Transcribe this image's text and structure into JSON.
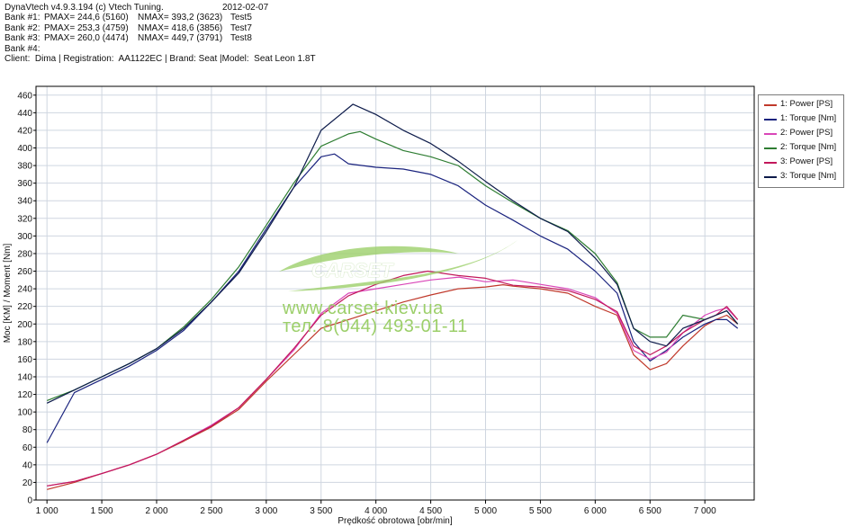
{
  "header": {
    "line1": {
      "app": "DynaVtech v4.9.3.194 (c) Vtech Tuning.",
      "date": "2012-02-07"
    },
    "banks": [
      {
        "label": "Bank #1:",
        "pmax": "PMAX= 244,6 (5160)",
        "nmax": "NMAX= 393,2 (3623)",
        "test": "Test5"
      },
      {
        "label": "Bank #2:",
        "pmax": "PMAX= 253,3 (4759)",
        "nmax": "NMAX= 418,6 (3856)",
        "test": "Test7"
      },
      {
        "label": "Bank #3:",
        "pmax": "PMAX= 260,0 (4474)",
        "nmax": "NMAX= 449,7 (3791)",
        "test": "Test8"
      },
      {
        "label": "Bank #4:",
        "pmax": "",
        "nmax": "",
        "test": ""
      }
    ],
    "client_line": "Client:  Dima | Registration:  AA1122EC | Brand: Seat |Model:  Seat Leon 1.8T"
  },
  "watermark": {
    "brand": "CARSET",
    "url": "www.carset.kiev.ua",
    "phone": "тел. 8(044) 493-01-11"
  },
  "colors": {
    "frame": "#000000",
    "grid": "#cfd6e0",
    "bg": "#ffffff",
    "watermark": "#9ccf6a"
  },
  "chart_data": {
    "type": "line",
    "xlabel": "Prędkość obrotowa [obr/min]",
    "ylabel": "Moc [KM] / Moment [Nm]",
    "xlim": [
      900,
      7450
    ],
    "ylim": [
      0,
      470
    ],
    "x_ticks": [
      1000,
      1500,
      2000,
      2500,
      3000,
      3500,
      4000,
      4500,
      5000,
      5500,
      6000,
      6500,
      7000
    ],
    "x_tick_labels": [
      "1 000",
      "1 500",
      "2 000",
      "2 500",
      "3 000",
      "3 500",
      "4 000",
      "4 500",
      "5 000",
      "5 500",
      "6 000",
      "6 500",
      "7 000"
    ],
    "y_ticks": [
      0,
      20,
      40,
      60,
      80,
      100,
      120,
      140,
      160,
      180,
      200,
      220,
      240,
      260,
      280,
      300,
      320,
      340,
      360,
      380,
      400,
      420,
      440,
      460
    ],
    "grid": true,
    "legend_position": "right",
    "series": [
      {
        "name": "1: Power [PS]",
        "color": "#c0392b",
        "x": [
          1000,
          1250,
          1500,
          1750,
          2000,
          2250,
          2500,
          2750,
          3000,
          3250,
          3500,
          3750,
          4000,
          4250,
          4500,
          4750,
          5000,
          5160,
          5250,
          5500,
          5750,
          6000,
          6200,
          6350,
          6500,
          6650,
          6800,
          7000,
          7100,
          7200,
          7300
        ],
        "y": [
          12,
          20,
          30,
          40,
          52,
          67,
          83,
          103,
          135,
          165,
          195,
          205,
          215,
          225,
          233,
          240,
          242,
          244.6,
          243,
          240,
          235,
          220,
          210,
          165,
          148,
          155,
          175,
          198,
          205,
          210,
          200
        ]
      },
      {
        "name": "1: Torque [Nm]",
        "color": "#1a237e",
        "x": [
          1000,
          1250,
          1500,
          1750,
          2000,
          2250,
          2500,
          2750,
          3000,
          3250,
          3500,
          3623,
          3750,
          4000,
          4250,
          4500,
          4750,
          5000,
          5250,
          5500,
          5750,
          6000,
          6200,
          6350,
          6500,
          6650,
          6800,
          7000,
          7100,
          7200,
          7300
        ],
        "y": [
          65,
          122,
          137,
          152,
          170,
          193,
          225,
          260,
          308,
          355,
          390,
          393.2,
          382,
          378,
          376,
          370,
          357,
          335,
          318,
          300,
          285,
          260,
          235,
          180,
          158,
          170,
          185,
          200,
          205,
          205,
          195
        ]
      },
      {
        "name": "2: Power [PS]",
        "color": "#d946b8",
        "x": [
          1000,
          1250,
          1500,
          1750,
          2000,
          2250,
          2500,
          2750,
          3000,
          3250,
          3500,
          3750,
          4000,
          4250,
          4500,
          4759,
          5000,
          5250,
          5500,
          5750,
          6000,
          6200,
          6350,
          6500,
          6650,
          6800,
          7000,
          7100,
          7200,
          7300
        ],
        "y": [
          16,
          21,
          30,
          40,
          52,
          68,
          85,
          105,
          137,
          170,
          212,
          235,
          240,
          245,
          250,
          253.3,
          248,
          250,
          245,
          240,
          230,
          212,
          170,
          160,
          168,
          190,
          210,
          215,
          218,
          205
        ]
      },
      {
        "name": "2: Torque [Nm]",
        "color": "#2e7d32",
        "x": [
          1000,
          1250,
          1500,
          1750,
          2000,
          2250,
          2500,
          2750,
          3000,
          3250,
          3500,
          3750,
          3856,
          4000,
          4250,
          4500,
          4750,
          5000,
          5250,
          5500,
          5750,
          6000,
          6200,
          6350,
          6500,
          6650,
          6800,
          7000,
          7100,
          7200,
          7300
        ],
        "y": [
          113,
          125,
          140,
          155,
          172,
          197,
          228,
          265,
          312,
          360,
          402,
          416,
          418.6,
          410,
          397,
          390,
          380,
          357,
          338,
          320,
          306,
          280,
          247,
          195,
          185,
          185,
          210,
          205,
          210,
          215,
          200
        ]
      },
      {
        "name": "3: Power [PS]",
        "color": "#c2185b",
        "x": [
          1000,
          1250,
          1500,
          1750,
          2000,
          2250,
          2500,
          2750,
          3000,
          3250,
          3500,
          3750,
          4000,
          4250,
          4474,
          4750,
          5000,
          5250,
          5500,
          5750,
          6000,
          6200,
          6350,
          6500,
          6650,
          6800,
          7000,
          7100,
          7200,
          7300
        ],
        "y": [
          16,
          21,
          30,
          40,
          52,
          68,
          84,
          105,
          137,
          172,
          210,
          232,
          245,
          255,
          260,
          255,
          252,
          244,
          242,
          238,
          228,
          214,
          175,
          165,
          175,
          190,
          205,
          210,
          220,
          205
        ]
      },
      {
        "name": "3: Torque [Nm]",
        "color": "#0d1b4a",
        "x": [
          1000,
          1250,
          1500,
          1750,
          2000,
          2250,
          2500,
          2750,
          3000,
          3250,
          3500,
          3791,
          4000,
          4250,
          4500,
          4750,
          5000,
          5250,
          5500,
          5750,
          6000,
          6200,
          6350,
          6500,
          6650,
          6800,
          7000,
          7100,
          7200,
          7300
        ],
        "y": [
          110,
          125,
          140,
          155,
          172,
          195,
          225,
          258,
          305,
          355,
          420,
          449.7,
          438,
          420,
          405,
          385,
          362,
          340,
          320,
          305,
          275,
          245,
          195,
          180,
          175,
          195,
          205,
          210,
          215,
          200
        ]
      }
    ]
  }
}
